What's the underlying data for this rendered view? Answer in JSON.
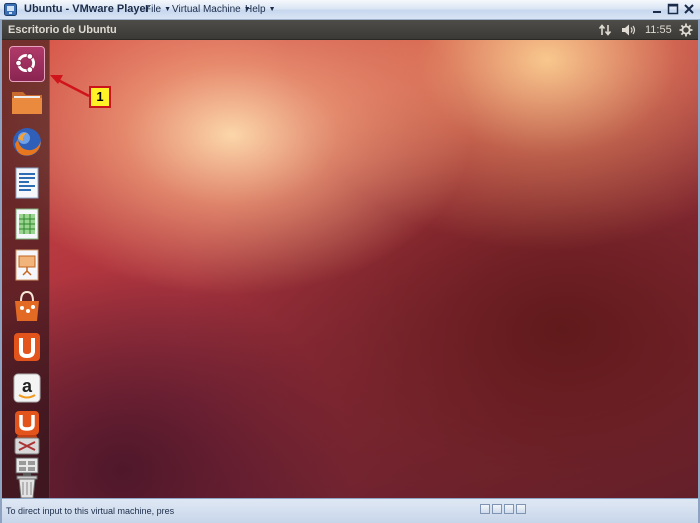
{
  "window": {
    "title": "Ubuntu - VMware Player",
    "menus": [
      "File",
      "Virtual Machine",
      "Help"
    ]
  },
  "panel": {
    "title": "Escritorio de Ubuntu",
    "clock": "11:55"
  },
  "launcher": {
    "items": [
      {
        "name": "Dash",
        "icon": "ubuntu-logo-icon"
      },
      {
        "name": "Files",
        "icon": "folder-icon"
      },
      {
        "name": "Firefox",
        "icon": "firefox-icon"
      },
      {
        "name": "LibreOffice Writer",
        "icon": "writer-icon"
      },
      {
        "name": "LibreOffice Calc",
        "icon": "calc-icon"
      },
      {
        "name": "LibreOffice Impress",
        "icon": "impress-icon"
      },
      {
        "name": "Ubuntu Software Center",
        "icon": "software-center-icon"
      },
      {
        "name": "Ubuntu One",
        "icon": "ubuntu-one-icon"
      },
      {
        "name": "Amazon",
        "icon": "amazon-icon"
      },
      {
        "name": "Ubuntu One Music",
        "icon": "ubuntu-one-music-icon"
      },
      {
        "name": "Settings",
        "icon": "settings-icon"
      },
      {
        "name": "Workspaces",
        "icon": "workspaces-icon"
      },
      {
        "name": "Trash",
        "icon": "trash-icon"
      }
    ]
  },
  "annotation": {
    "callout_label": "1",
    "callout_color": "#fff226",
    "arrow_color": "#d0141c"
  },
  "statusbar": {
    "text": "To direct input to this virtual machine, press Ctrl+G"
  },
  "colors": {
    "ubuntu_orange": "#dd4814",
    "panel_dark": "#3c3b37",
    "vmware_blue": "#c7d7ee"
  }
}
